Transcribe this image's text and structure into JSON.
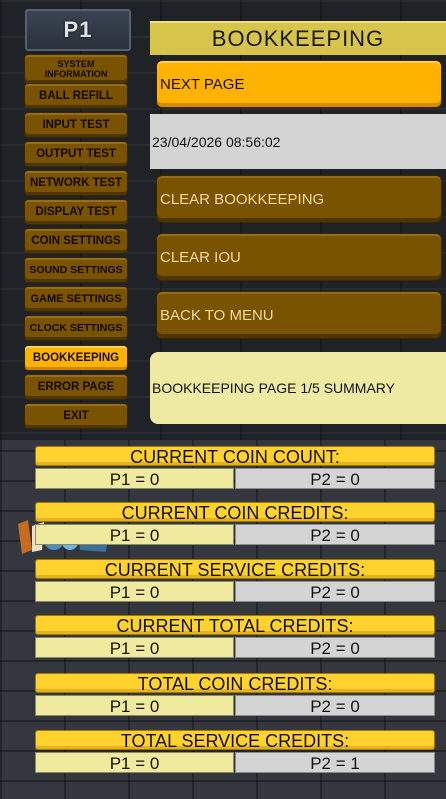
{
  "player_label": "P1",
  "sidebar": {
    "items": [
      {
        "label": "SYSTEM INFORMATION",
        "active": false
      },
      {
        "label": "BALL REFILL",
        "active": false
      },
      {
        "label": "INPUT TEST",
        "active": false
      },
      {
        "label": "OUTPUT TEST",
        "active": false
      },
      {
        "label": "NETWORK TEST",
        "active": false
      },
      {
        "label": "DISPLAY TEST",
        "active": false
      },
      {
        "label": "COIN SETTINGS",
        "active": false
      },
      {
        "label": "SOUND SETTINGS",
        "active": false
      },
      {
        "label": "GAME SETTINGS",
        "active": false
      },
      {
        "label": "CLOCK SETTINGS",
        "active": false
      },
      {
        "label": "BOOKKEEPING",
        "active": true
      },
      {
        "label": "ERROR PAGE",
        "active": false
      },
      {
        "label": "EXIT",
        "active": false
      }
    ]
  },
  "main": {
    "title": "BOOKKEEPING",
    "next_page_label": "NEXT PAGE",
    "datetime": "23/04/2026 08:56:02",
    "clear_bookkeeping_label": "CLEAR BOOKKEEPING",
    "clear_iou_label": "CLEAR IOU",
    "back_to_menu_label": "BACK TO MENU",
    "summary": "BOOKKEEPING PAGE 1/5 SUMMARY"
  },
  "stats": [
    {
      "title": "CURRENT COIN COUNT:",
      "p1": "P1 = 0",
      "p2": "P2 = 0"
    },
    {
      "title": "CURRENT COIN CREDITS:",
      "p1": "P1 = 0",
      "p2": "P2 = 0"
    },
    {
      "title": "CURRENT SERVICE CREDITS:",
      "p1": "P1 = 0",
      "p2": "P2 = 0"
    },
    {
      "title": "CURRENT TOTAL  CREDITS:",
      "p1": "P1 = 0",
      "p2": "P2 = 0"
    },
    {
      "title": "TOTAL COIN  CREDITS:",
      "p1": "P1 = 0",
      "p2": "P2 = 0"
    },
    {
      "title": "TOTAL SERVICE  CREDITS:",
      "p1": "P1 = 0",
      "p2": "P2 = 1"
    }
  ],
  "colors": {
    "button": "#7a5300",
    "button_active": "#ffb300",
    "title_bar": "#d6c54a",
    "stat_title": "#ffd22e",
    "p1_cell": "#f0ea9e",
    "p2_cell": "#d4d4d4"
  }
}
